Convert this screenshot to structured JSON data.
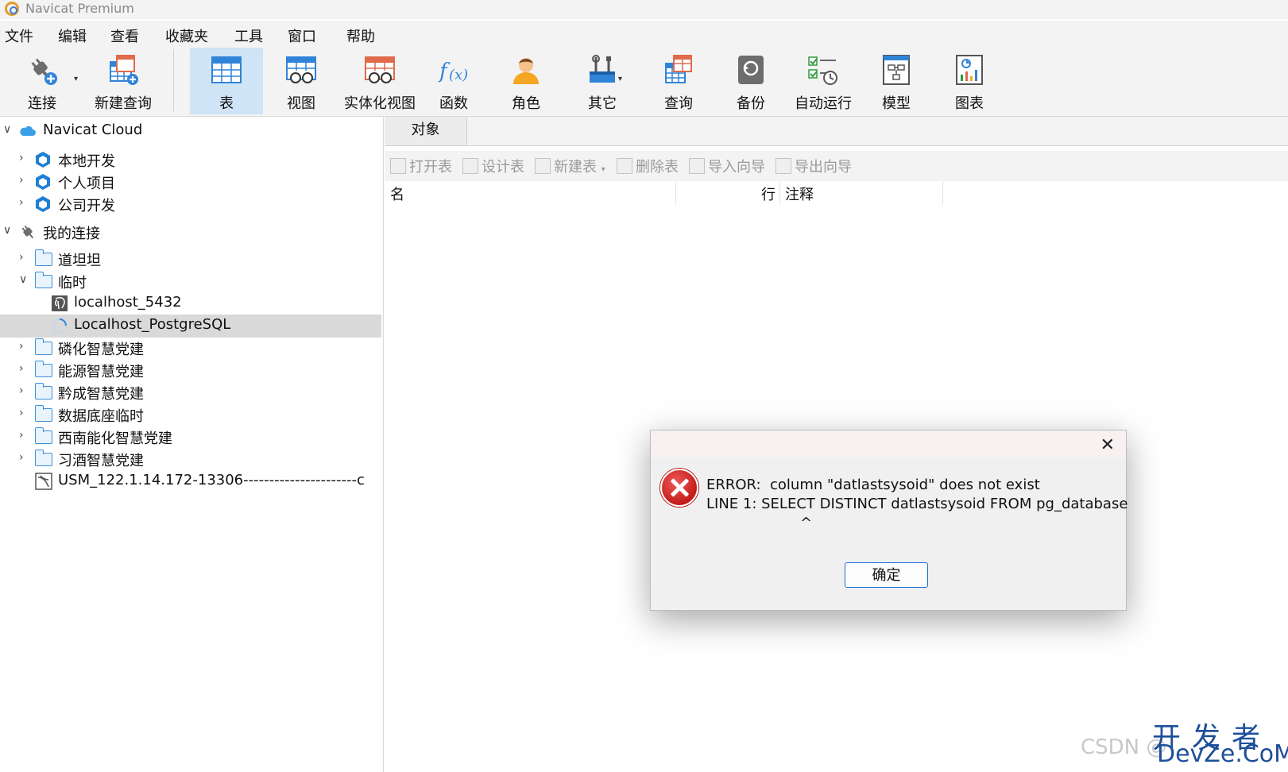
{
  "window": {
    "title": "Navicat Premium"
  },
  "menu": [
    "文件",
    "编辑",
    "查看",
    "收藏夹",
    "工具",
    "窗口",
    "帮助"
  ],
  "toolbar": {
    "connect": "连接",
    "new_query": "新建查询",
    "table": "表",
    "view": "视图",
    "materialized_view": "实体化视图",
    "function": "函数",
    "role": "角色",
    "other": "其它",
    "query": "查询",
    "backup": "备份",
    "automation": "自动运行",
    "model": "模型",
    "chart": "图表"
  },
  "sidebar": {
    "cloud": "Navicat Cloud",
    "cloud_items": [
      "本地开发",
      "个人项目",
      "公司开发"
    ],
    "connections_root": "我的连接",
    "folders": {
      "f1": "道坦坦",
      "f2": "临时",
      "conn1": "localhost_5432",
      "conn2": "Localhost_PostgreSQL",
      "f3": "磷化智慧党建",
      "f4": "能源智慧党建",
      "f5": "黔成智慧党建",
      "f6": "数据底座临时",
      "f7": "西南能化智慧党建",
      "f8": "习酒智慧党建",
      "mysql": "USM_122.1.14.172-13306----------------------c"
    }
  },
  "objects": {
    "tab": "对象",
    "buttons": [
      "打开表",
      "设计表",
      "新建表",
      "删除表",
      "导入向导",
      "导出向导"
    ],
    "columns": {
      "name": "名",
      "rows": "行",
      "comment": "注释"
    }
  },
  "dialog": {
    "line1": "ERROR:  column \"datlastsysoid\" does not exist",
    "line2": "LINE 1: SELECT DISTINCT datlastsysoid FROM pg_database",
    "line3": "^",
    "ok": "确定",
    "close_glyph": "✕"
  },
  "watermark": {
    "cn": "开发者",
    "en": "DevZe.CoM",
    "csdn": "CSDN @"
  },
  "colors": {
    "accent": "#1f6fd1",
    "selected_row": "#d9d9d9",
    "active_tool": "#cfe5f7",
    "error": "#c41a1a"
  }
}
